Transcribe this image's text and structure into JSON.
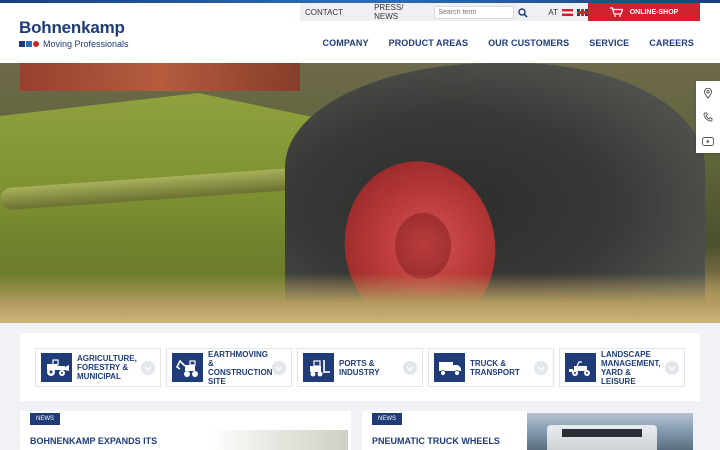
{
  "brand": {
    "name": "Bohnenkamp",
    "tagline": "Moving Professionals"
  },
  "utility": {
    "contact": "CONTACT",
    "press": "PRESS/ NEWS",
    "search_placeholder": "Search term",
    "lang": "AT",
    "shop": "ONLINE-SHOP"
  },
  "nav": [
    "COMPANY",
    "PRODUCT AREAS",
    "OUR CUSTOMERS",
    "SERVICE",
    "CAREERS"
  ],
  "side_tools": [
    "location-pin-icon",
    "phone-icon",
    "youtube-icon"
  ],
  "categories": [
    "AGRICULTURE, FORESTRY & MUNICIPAL",
    "EARTHMOVING & CONSTRUCTION SITE",
    "PORTS & INDUSTRY",
    "TRUCK & TRANSPORT",
    "LANDSCAPE MANAGEMENT, YARD & LEISURE"
  ],
  "news": [
    {
      "badge": "NEWS",
      "title": "BOHNENKAMP EXPANDS ITS"
    },
    {
      "badge": "NEWS",
      "title": "PNEUMATIC TRUCK WHEELS"
    }
  ],
  "colors": {
    "brand_blue": "#1f3c78",
    "accent_red": "#d0222e"
  }
}
